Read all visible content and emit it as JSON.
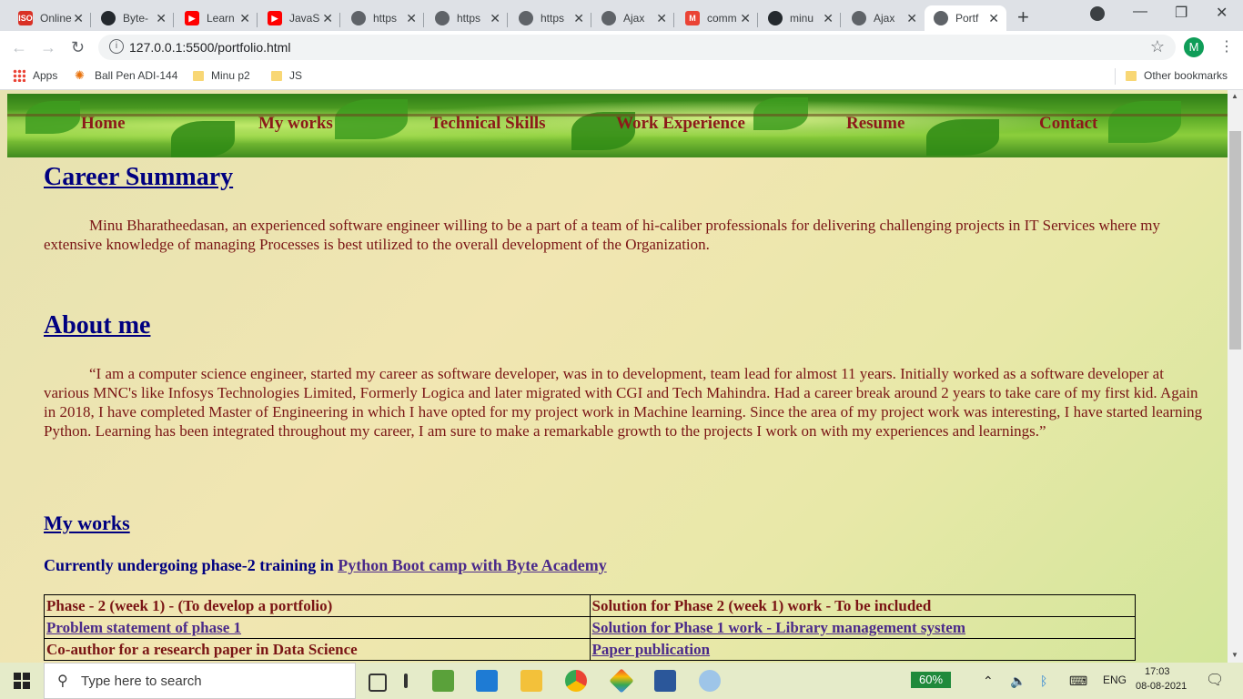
{
  "browser": {
    "tabs": [
      {
        "title": "Online",
        "fav_text": "ISO",
        "fav_color": "#d93025"
      },
      {
        "title": "Byte-",
        "fav_text": "",
        "fav_color": "#24292e"
      },
      {
        "title": "Learn",
        "fav_text": "▶",
        "fav_color": "#ff0000"
      },
      {
        "title": "JavaS",
        "fav_text": "▶",
        "fav_color": "#ff0000"
      },
      {
        "title": "https",
        "fav_text": "",
        "fav_color": "#5f6368"
      },
      {
        "title": "https",
        "fav_text": "",
        "fav_color": "#5f6368"
      },
      {
        "title": "https",
        "fav_text": "",
        "fav_color": "#5f6368"
      },
      {
        "title": "Ajax",
        "fav_text": "",
        "fav_color": "#5f6368"
      },
      {
        "title": "comm",
        "fav_text": "M",
        "fav_color": "#ea4335"
      },
      {
        "title": "minu",
        "fav_text": "",
        "fav_color": "#24292e"
      },
      {
        "title": "Ajax",
        "fav_text": "",
        "fav_color": "#5f6368"
      },
      {
        "title": "Portf",
        "fav_text": "",
        "fav_color": "#5f6368"
      }
    ],
    "url": "127.0.0.1:5500/portfolio.html",
    "profile_initial": "M",
    "bookmarks": [
      "Apps",
      "Ball Pen ADI-144",
      "Minu p2",
      "JS"
    ],
    "other_bookmarks": "Other bookmarks"
  },
  "nav": [
    "Home",
    "My works",
    "Technical Skills",
    "Work Experience",
    "Resume",
    "Contact"
  ],
  "career": {
    "heading": "Career Summary",
    "text": "Minu Bharatheedasan, an experienced software engineer willing to be a part of a team of hi-caliber professionals for delivering challenging projects in IT Services where my extensive knowledge of managing Processes is best utilized to the overall development of the Organization."
  },
  "about": {
    "heading": "About me",
    "text": "“I am a computer science engineer, started my career as software developer, was in to development, team lead for almost 11 years. Initially worked as a software developer at various MNC's like Infosys Technologies Limited, Formerly Logica and later migrated with CGI and Tech Mahindra. Had a career break around 2 years to take care of my first kid. Again in 2018, I have completed Master of Engineering in which I have opted for my project work in Machine learning. Since the area of my project work was interesting, I have started learning Python. Learning has been integrated throughout my career, I am sure to make a remarkable growth to the projects I work on with my experiences and learnings.”"
  },
  "works": {
    "heading": "My works",
    "training_prefix": "Currently undergoing phase-2 training in",
    "training_link": "Python Boot camp with Byte Academy",
    "rows": [
      [
        "Phase - 2 (week 1) - (To develop a portfolio)",
        "Solution for Phase 2 (week 1) work - To be included"
      ],
      [
        "Problem statement of phase 1",
        "Solution for Phase 1 work - Library management system"
      ],
      [
        "Co-author for a research paper in Data Science",
        "Paper publication"
      ]
    ]
  },
  "taskbar": {
    "search_placeholder": "Type here to search",
    "battery": "60%",
    "lang": "ENG",
    "time": "17:03",
    "date": "08-08-2021"
  }
}
